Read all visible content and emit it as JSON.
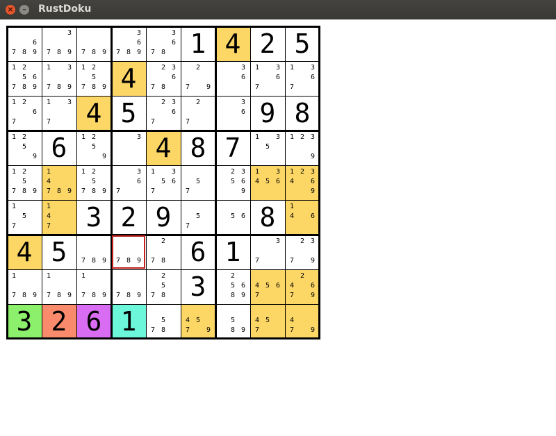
{
  "window": {
    "title": "RustDoku",
    "close_glyph": "×",
    "minimize_glyph": "–"
  },
  "colors": {
    "highlight": "#fcd766",
    "cell_default": "#ffffff",
    "green": "#8cf06c",
    "orange": "#f98a6c",
    "purple": "#d86cf2",
    "teal": "#6cf7da",
    "selection": "#c0201e"
  },
  "board": {
    "selected": {
      "row": 6,
      "col": 3
    },
    "cells": [
      [
        {
          "cand": [
            6,
            7,
            8,
            9
          ],
          "bg": "#ffffff"
        },
        {
          "cand": [
            3,
            7,
            8,
            9
          ],
          "bg": "#ffffff"
        },
        {
          "cand": [
            7,
            8,
            9
          ],
          "bg": "#ffffff"
        },
        {
          "cand": [
            3,
            6,
            7,
            8,
            9
          ],
          "bg": "#ffffff"
        },
        {
          "cand": [
            3,
            6,
            7,
            8
          ],
          "bg": "#ffffff"
        },
        {
          "value": 1,
          "bg": "#ffffff"
        },
        {
          "value": 4,
          "bg": "#fcd766"
        },
        {
          "value": 2,
          "bg": "#ffffff"
        },
        {
          "value": 5,
          "bg": "#ffffff"
        }
      ],
      [
        {
          "cand": [
            1,
            2,
            5,
            6,
            7,
            8,
            9
          ],
          "bg": "#ffffff"
        },
        {
          "cand": [
            1,
            3,
            7,
            8,
            9
          ],
          "bg": "#ffffff"
        },
        {
          "cand": [
            1,
            2,
            5,
            7,
            8,
            9
          ],
          "bg": "#ffffff"
        },
        {
          "value": 4,
          "bg": "#fcd766"
        },
        {
          "cand": [
            2,
            3,
            6,
            7,
            8
          ],
          "bg": "#ffffff"
        },
        {
          "cand": [
            2,
            7,
            9
          ],
          "bg": "#ffffff"
        },
        {
          "cand": [
            3,
            6
          ],
          "bg": "#ffffff"
        },
        {
          "cand": [
            1,
            3,
            6,
            7
          ],
          "bg": "#ffffff"
        },
        {
          "cand": [
            1,
            3,
            6,
            7
          ],
          "bg": "#ffffff"
        }
      ],
      [
        {
          "cand": [
            1,
            2,
            6,
            7
          ],
          "bg": "#ffffff"
        },
        {
          "cand": [
            1,
            3,
            7
          ],
          "bg": "#ffffff"
        },
        {
          "value": 4,
          "bg": "#fcd766"
        },
        {
          "value": 5,
          "bg": "#ffffff"
        },
        {
          "cand": [
            2,
            3,
            6,
            7
          ],
          "bg": "#ffffff"
        },
        {
          "cand": [
            2,
            7
          ],
          "bg": "#ffffff"
        },
        {
          "cand": [
            3,
            6
          ],
          "bg": "#ffffff"
        },
        {
          "value": 9,
          "bg": "#ffffff"
        },
        {
          "value": 8,
          "bg": "#ffffff"
        }
      ],
      [
        {
          "cand": [
            1,
            2,
            5,
            9
          ],
          "bg": "#ffffff"
        },
        {
          "value": 6,
          "bg": "#ffffff"
        },
        {
          "cand": [
            1,
            2,
            5,
            9
          ],
          "bg": "#ffffff"
        },
        {
          "cand": [
            3
          ],
          "bg": "#ffffff"
        },
        {
          "value": 4,
          "bg": "#fcd766"
        },
        {
          "value": 8,
          "bg": "#ffffff"
        },
        {
          "value": 7,
          "bg": "#ffffff"
        },
        {
          "cand": [
            1,
            3,
            5
          ],
          "bg": "#ffffff"
        },
        {
          "cand": [
            1,
            2,
            3,
            9
          ],
          "bg": "#ffffff"
        }
      ],
      [
        {
          "cand": [
            1,
            2,
            5,
            7,
            8,
            9
          ],
          "bg": "#ffffff"
        },
        {
          "cand": [
            1,
            4,
            7,
            8,
            9
          ],
          "bg": "#fcd766"
        },
        {
          "cand": [
            1,
            2,
            5,
            7,
            8,
            9
          ],
          "bg": "#ffffff"
        },
        {
          "cand": [
            3,
            6,
            7
          ],
          "bg": "#ffffff"
        },
        {
          "cand": [
            1,
            3,
            5,
            6,
            7
          ],
          "bg": "#ffffff"
        },
        {
          "cand": [
            5,
            7
          ],
          "bg": "#ffffff"
        },
        {
          "cand": [
            2,
            3,
            5,
            6,
            9
          ],
          "bg": "#ffffff"
        },
        {
          "cand": [
            1,
            3,
            4,
            5,
            6
          ],
          "bg": "#fcd766"
        },
        {
          "cand": [
            1,
            2,
            3,
            4,
            6,
            9
          ],
          "bg": "#fcd766"
        }
      ],
      [
        {
          "cand": [
            1,
            5,
            7
          ],
          "bg": "#ffffff"
        },
        {
          "cand": [
            1,
            4,
            7
          ],
          "bg": "#fcd766"
        },
        {
          "value": 3,
          "bg": "#ffffff"
        },
        {
          "value": 2,
          "bg": "#ffffff"
        },
        {
          "value": 9,
          "bg": "#ffffff"
        },
        {
          "cand": [
            5,
            7
          ],
          "bg": "#ffffff"
        },
        {
          "cand": [
            5,
            6
          ],
          "bg": "#ffffff"
        },
        {
          "value": 8,
          "bg": "#ffffff"
        },
        {
          "cand": [
            1,
            4,
            6
          ],
          "bg": "#fcd766"
        }
      ],
      [
        {
          "value": 4,
          "bg": "#fcd766"
        },
        {
          "value": 5,
          "bg": "#ffffff"
        },
        {
          "cand": [
            7,
            8,
            9
          ],
          "bg": "#ffffff"
        },
        {
          "cand": [
            7,
            8,
            9
          ],
          "bg": "#ffffff"
        },
        {
          "cand": [
            2,
            7,
            8
          ],
          "bg": "#ffffff"
        },
        {
          "value": 6,
          "bg": "#ffffff"
        },
        {
          "value": 1,
          "bg": "#ffffff"
        },
        {
          "cand": [
            3,
            7
          ],
          "bg": "#ffffff"
        },
        {
          "cand": [
            2,
            3,
            7,
            9
          ],
          "bg": "#ffffff"
        }
      ],
      [
        {
          "cand": [
            1,
            7,
            8,
            9
          ],
          "bg": "#ffffff"
        },
        {
          "cand": [
            1,
            7,
            8,
            9
          ],
          "bg": "#ffffff"
        },
        {
          "cand": [
            1,
            7,
            8,
            9
          ],
          "bg": "#ffffff"
        },
        {
          "cand": [
            7,
            8,
            9
          ],
          "bg": "#ffffff"
        },
        {
          "cand": [
            2,
            5,
            7,
            8
          ],
          "bg": "#ffffff"
        },
        {
          "value": 3,
          "bg": "#ffffff"
        },
        {
          "cand": [
            2,
            5,
            6,
            8,
            9
          ],
          "bg": "#ffffff"
        },
        {
          "cand": [
            4,
            5,
            6,
            7
          ],
          "bg": "#fcd766"
        },
        {
          "cand": [
            2,
            4,
            6,
            7,
            9
          ],
          "bg": "#fcd766"
        }
      ],
      [
        {
          "value": 3,
          "bg": "#8cf06c"
        },
        {
          "value": 2,
          "bg": "#f98a6c"
        },
        {
          "value": 6,
          "bg": "#d86cf2"
        },
        {
          "value": 1,
          "bg": "#6cf7da"
        },
        {
          "cand": [
            5,
            7,
            8
          ],
          "bg": "#ffffff"
        },
        {
          "cand": [
            4,
            5,
            7,
            9
          ],
          "bg": "#fcd766"
        },
        {
          "cand": [
            5,
            8,
            9
          ],
          "bg": "#ffffff"
        },
        {
          "cand": [
            4,
            5,
            7
          ],
          "bg": "#fcd766"
        },
        {
          "cand": [
            4,
            7,
            9
          ],
          "bg": "#fcd766"
        }
      ]
    ]
  }
}
